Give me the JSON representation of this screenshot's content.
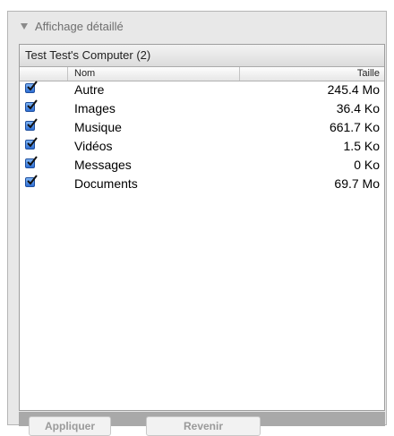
{
  "section": {
    "title": "Affichage détaillé"
  },
  "panel": {
    "title": "Test Test's Computer (2)"
  },
  "columns": {
    "name": "Nom",
    "size": "Taille"
  },
  "rows": [
    {
      "name": "Autre",
      "size": "245.4 Mo",
      "checked": true
    },
    {
      "name": "Images",
      "size": "36.4 Ko",
      "checked": true
    },
    {
      "name": "Musique",
      "size": "661.7 Ko",
      "checked": true
    },
    {
      "name": "Vidéos",
      "size": "1.5 Ko",
      "checked": true
    },
    {
      "name": "Messages",
      "size": "0 Ko",
      "checked": true
    },
    {
      "name": "Documents",
      "size": "69.7 Mo",
      "checked": true
    }
  ],
  "buttons": {
    "apply": "Appliquer",
    "revert": "Revenir"
  },
  "colors": {
    "checkbox": "#3a7de0",
    "panel_border": "#9e9e9e"
  }
}
